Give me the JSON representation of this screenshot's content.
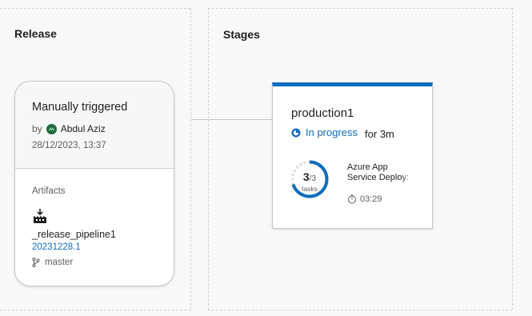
{
  "release": {
    "section_title": "Release",
    "trigger": "Manually triggered",
    "by_label": "by",
    "user": "Abdul Aziz",
    "date": "28/12/2023, 13:37",
    "artifacts_label": "Artifacts",
    "artifact": {
      "name": "_release_pipeline1",
      "version": "20231228.1",
      "branch": "master"
    }
  },
  "stages": {
    "section_title": "Stages",
    "stage": {
      "name": "production1",
      "status": "In progress",
      "duration": "for 3m",
      "tasks_completed": "3",
      "tasks_total": "/3",
      "tasks_label": "tasks",
      "progress_fraction": 1.0,
      "task_name": "Azure App Service Deploy:",
      "task_time": "03:29"
    }
  },
  "colors": {
    "accent": "#0f6cbd",
    "avatar": "#1e6b3a",
    "link": "#106ebe"
  },
  "icons": [
    "avatar-icon",
    "artifact-build-icon",
    "branch-icon",
    "in-progress-icon",
    "timer-icon"
  ]
}
